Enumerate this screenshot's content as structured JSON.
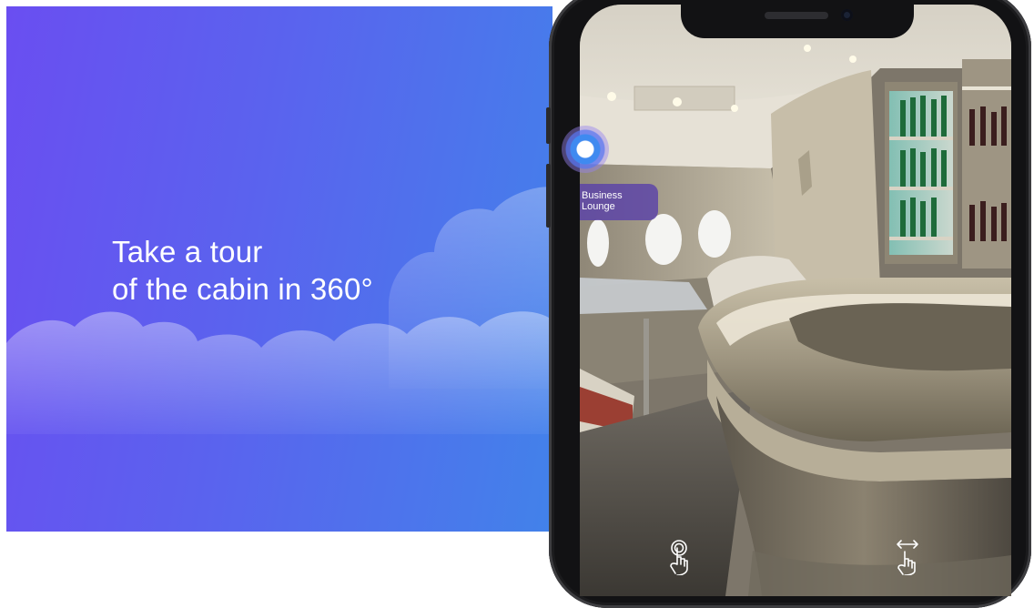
{
  "promo": {
    "headline_line1": "Take a tour",
    "headline_line2": "of the cabin in 360°"
  },
  "viewer": {
    "hotspot_label": "Business\nLounge",
    "hotspot_icon": "hotspot-marker-icon",
    "gesture_left_icon": "tap-gesture-icon",
    "gesture_right_icon": "swipe-gesture-icon"
  },
  "colors": {
    "gradient_start": "#6a4ef1",
    "gradient_end": "#4282ea",
    "hotspot_accent": "#3f8af0",
    "label_bg": "#5a42a8"
  }
}
